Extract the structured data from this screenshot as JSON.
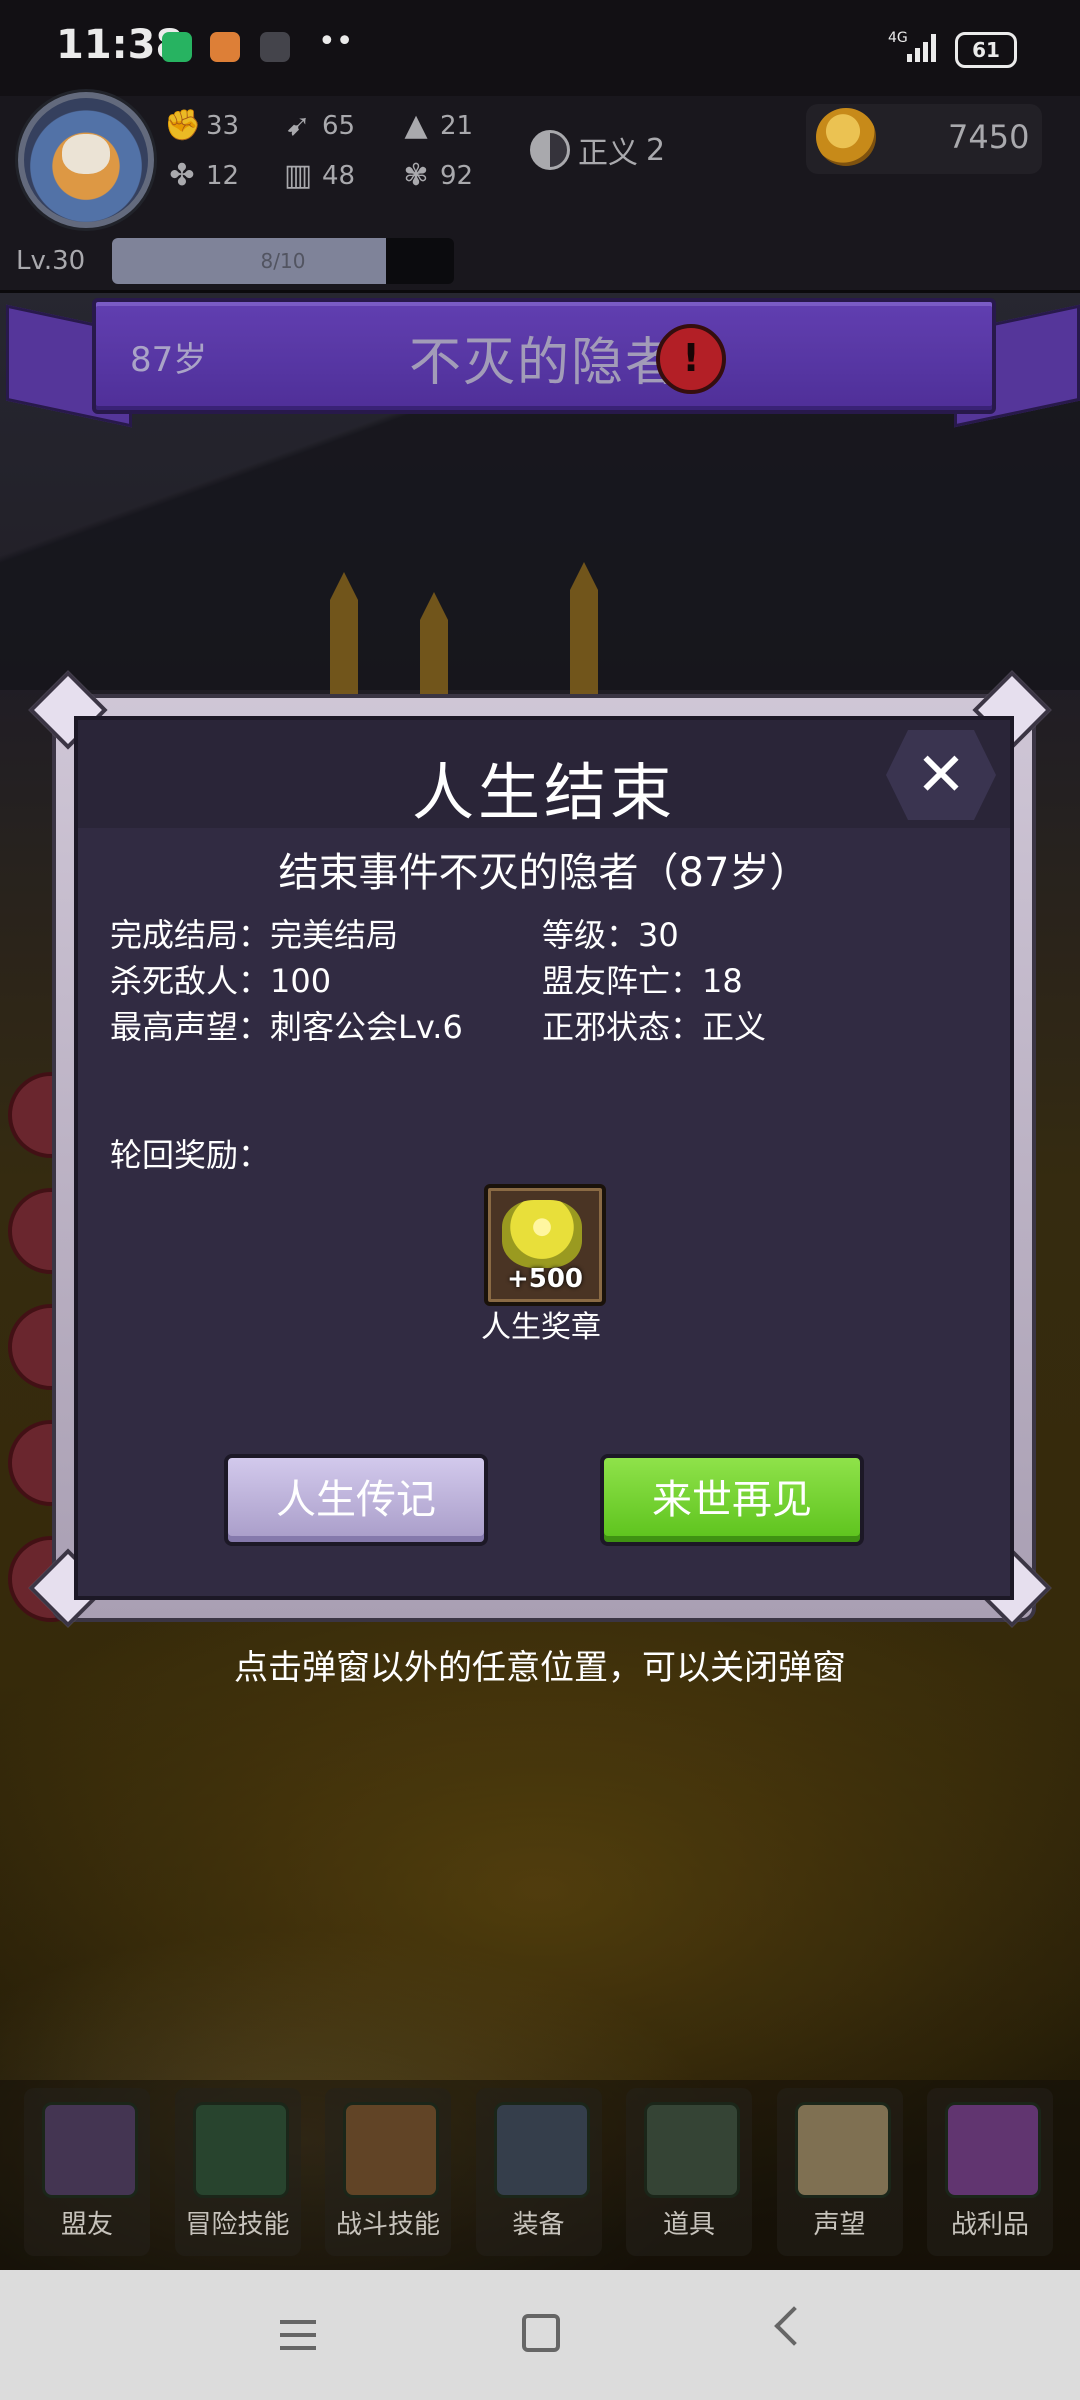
{
  "status_bar": {
    "time": "11:38",
    "network": "4G",
    "battery": "61"
  },
  "hud": {
    "stats": [
      {
        "icon": "fist-icon",
        "value": "33"
      },
      {
        "icon": "boot-icon",
        "value": "65"
      },
      {
        "icon": "wizard-hat-icon",
        "value": "21"
      },
      {
        "icon": "clover-icon",
        "value": "12"
      },
      {
        "icon": "book-icon",
        "value": "48"
      },
      {
        "icon": "lotus-icon",
        "value": "92"
      }
    ],
    "alignment": {
      "label": "正义",
      "value": "2"
    },
    "gold": "7450",
    "level": "Lv.30",
    "xp_text": "8/10",
    "xp_fraction": 0.8
  },
  "banner": {
    "age": "87岁",
    "title": "不灭的隐者"
  },
  "modal": {
    "title": "人生结束",
    "event_line": "结束事件不灭的隐者（87岁）",
    "info": {
      "ending": "完成结局：完美结局",
      "level": "等级：30",
      "kills": "杀死敌人：100",
      "ally_deaths": "盟友阵亡：18",
      "reputation": "最高声望：刺客公会Lv.6",
      "morality": "正邪状态：正义"
    },
    "reward_label": "轮回奖励：",
    "reward": {
      "count": "+500",
      "name": "人生奖章"
    },
    "buttons": {
      "biography": "人生传记",
      "next_life": "来世再见"
    }
  },
  "hint": "点击弹窗以外的任意位置，可以关闭弹窗",
  "bottom_nav": [
    {
      "label": "盟友",
      "icon": "glove-icon"
    },
    {
      "label": "冒险技能",
      "icon": "book-icon"
    },
    {
      "label": "战斗技能",
      "icon": "backpack-icon"
    },
    {
      "label": "装备",
      "icon": "swords-icon"
    },
    {
      "label": "道具",
      "icon": "satchel-icon"
    },
    {
      "label": "声望",
      "icon": "scroll-icon"
    },
    {
      "label": "战利品",
      "icon": "chest-icon"
    }
  ]
}
